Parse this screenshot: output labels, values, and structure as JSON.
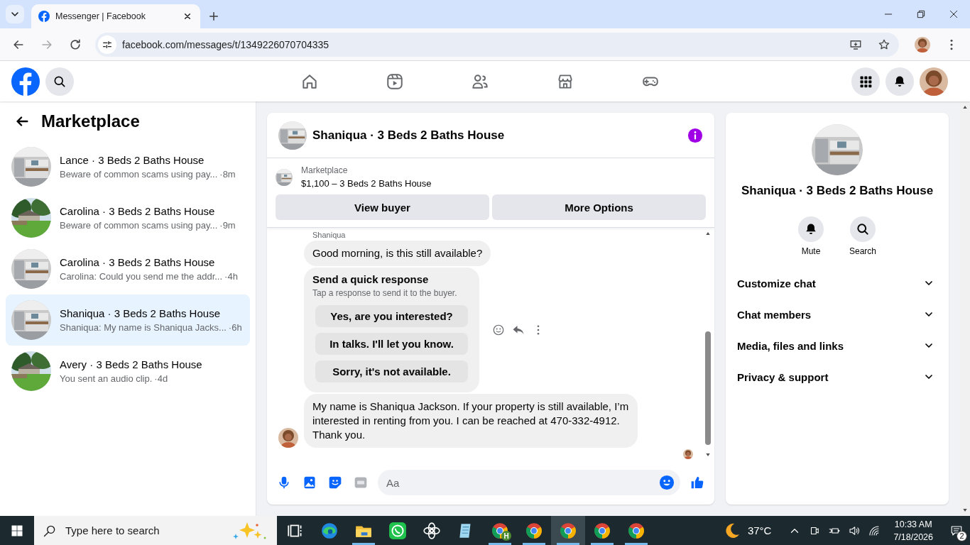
{
  "browser": {
    "tab_title": "Messenger | Facebook",
    "url": "facebook.com/messages/t/1349226070704335"
  },
  "sidebar": {
    "title": "Marketplace",
    "conversations": [
      {
        "name": "Lance · 3 Beds 2 Baths House",
        "preview": "Beware of common scams using pay...",
        "time": "·8m",
        "selected": false
      },
      {
        "name": "Carolina · 3 Beds 2 Baths House",
        "preview": "Beware of common scams using pay...",
        "time": "·9m",
        "selected": false
      },
      {
        "name": "Carolina · 3 Beds 2 Baths House",
        "preview": "Carolina: Could you send me the addr...",
        "time": "·4h",
        "selected": false
      },
      {
        "name": "Shaniqua · 3 Beds 2 Baths House",
        "preview": "Shaniqua: My name is Shaniqua Jacks...",
        "time": "·6h",
        "selected": true
      },
      {
        "name": "Avery · 3 Beds 2 Baths House",
        "preview": "You sent an audio clip.",
        "time": "·4d",
        "selected": false
      }
    ]
  },
  "chat": {
    "title": "Shaniqua · 3 Beds 2 Baths House",
    "listing": {
      "source": "Marketplace",
      "title": "$1,100 – 3 Beds 2 Baths House"
    },
    "buttons": [
      "View buyer",
      "More Options"
    ],
    "messages": [
      {
        "kind": "sender",
        "text": "Shaniqua"
      },
      {
        "kind": "bubble",
        "text": "Good morning, is this still available?",
        "avatar": false
      },
      {
        "kind": "quick_responses",
        "title": "Send a quick response",
        "subtitle": "Tap a response to send it to the buyer.",
        "options": [
          "Yes, are you interested?",
          "In talks. I'll let you know.",
          "Sorry, it's not available."
        ]
      },
      {
        "kind": "bubble",
        "text": "My name is Shaniqua Jackson. If your property is still available, I’m interested in renting from you. I can be reached at 470-332-4912. Thank you.",
        "avatar": true
      }
    ],
    "composer": {
      "placeholder": "Aa"
    }
  },
  "details": {
    "name": "Shaniqua · 3 Beds 2 Baths House",
    "actions": [
      {
        "kind": "mute",
        "label": "Mute"
      },
      {
        "kind": "search",
        "label": "Search"
      }
    ],
    "sections": [
      "Customize chat",
      "Chat members",
      "Media, files and links",
      "Privacy & support"
    ]
  },
  "taskbar": {
    "search_placeholder": "Type here to search",
    "apps": [
      {
        "kind": "task_view",
        "running": false,
        "selected": false
      },
      {
        "kind": "edge",
        "running": false,
        "selected": false
      },
      {
        "kind": "folder",
        "running": true,
        "selected": false
      },
      {
        "kind": "chat",
        "running": false,
        "selected": false
      },
      {
        "kind": "knot",
        "running": false,
        "selected": false
      },
      {
        "kind": "notepad",
        "running": false,
        "selected": false
      },
      {
        "kind": "chrome",
        "badge": "H",
        "running": true,
        "selected": false
      },
      {
        "kind": "chrome",
        "running": true,
        "selected": false
      },
      {
        "kind": "chrome",
        "running": true,
        "selected": true
      },
      {
        "kind": "chrome",
        "running": true,
        "selected": false
      },
      {
        "kind": "chrome",
        "running": true,
        "selected": false
      }
    ],
    "weather": "37°C",
    "time": "10:33 AM",
    "date": "7/18/2026",
    "notifications": "2"
  }
}
